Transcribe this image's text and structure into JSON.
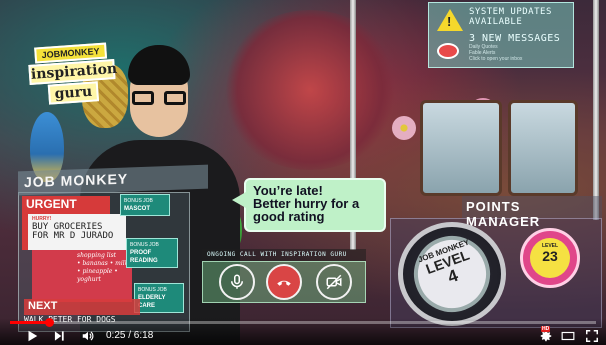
{
  "app": {
    "logo": {
      "line1": "JOBMONKEY",
      "line2": "inspiration",
      "line3": "guru"
    }
  },
  "notification": {
    "title_line1": "SYSTEM UPDATES",
    "title_line2": "AVAILABLE",
    "messages": "3 NEW MESSAGES",
    "detail_line1": "Daily Quotes",
    "detail_line2": "Fable Alerts",
    "footer": "Click to open your inbox",
    "accent": "#f5d82c"
  },
  "job_monkey": {
    "title": "JOB MONKEY",
    "urgent_label": "URGENT",
    "urgent_sub": "HURRY!",
    "urgent_task": "BUY GROCERIES FOR MR D JURADO",
    "shopping_title": "shopping list",
    "shopping_items": "• bananas • milk • pineapple • yoghurt",
    "bonus_jobs": [
      {
        "label": "BONUS JOB",
        "task": "MASCOT"
      },
      {
        "label": "BONUS JOB",
        "task": "PROOF READING"
      },
      {
        "label": "BONUS JOB",
        "task": "ELDERLY CARE"
      }
    ],
    "next_label": "NEXT",
    "next_task": "WALK PETER FOR DOGS",
    "urgent_color": "#d63a3a",
    "bonus_color": "#1e8a7a"
  },
  "speech_bubble": {
    "line1": "You’re late!",
    "line2": "Better hurry for a",
    "line3": "good rating"
  },
  "call": {
    "label": "ONGOING CALL WITH INSPIRATION GURU",
    "mic_icon": "microphone-icon",
    "hangup_icon": "phone-hangup-icon",
    "video_icon": "video-off-icon",
    "hangup_color": "#d94545"
  },
  "points_manager": {
    "title": "POINTS MANAGER",
    "level_brand": "JOB MONKEY",
    "level_word": "LEVEL",
    "level_value": "4",
    "badge_label": "LEVEL",
    "badge_value": "23"
  },
  "player": {
    "current_time": "0:25",
    "duration": "6:18",
    "time_display": "0:25 / 6:18",
    "progress_fraction": 0.066,
    "hd_badge": "HD",
    "accent": "#ff0000"
  }
}
